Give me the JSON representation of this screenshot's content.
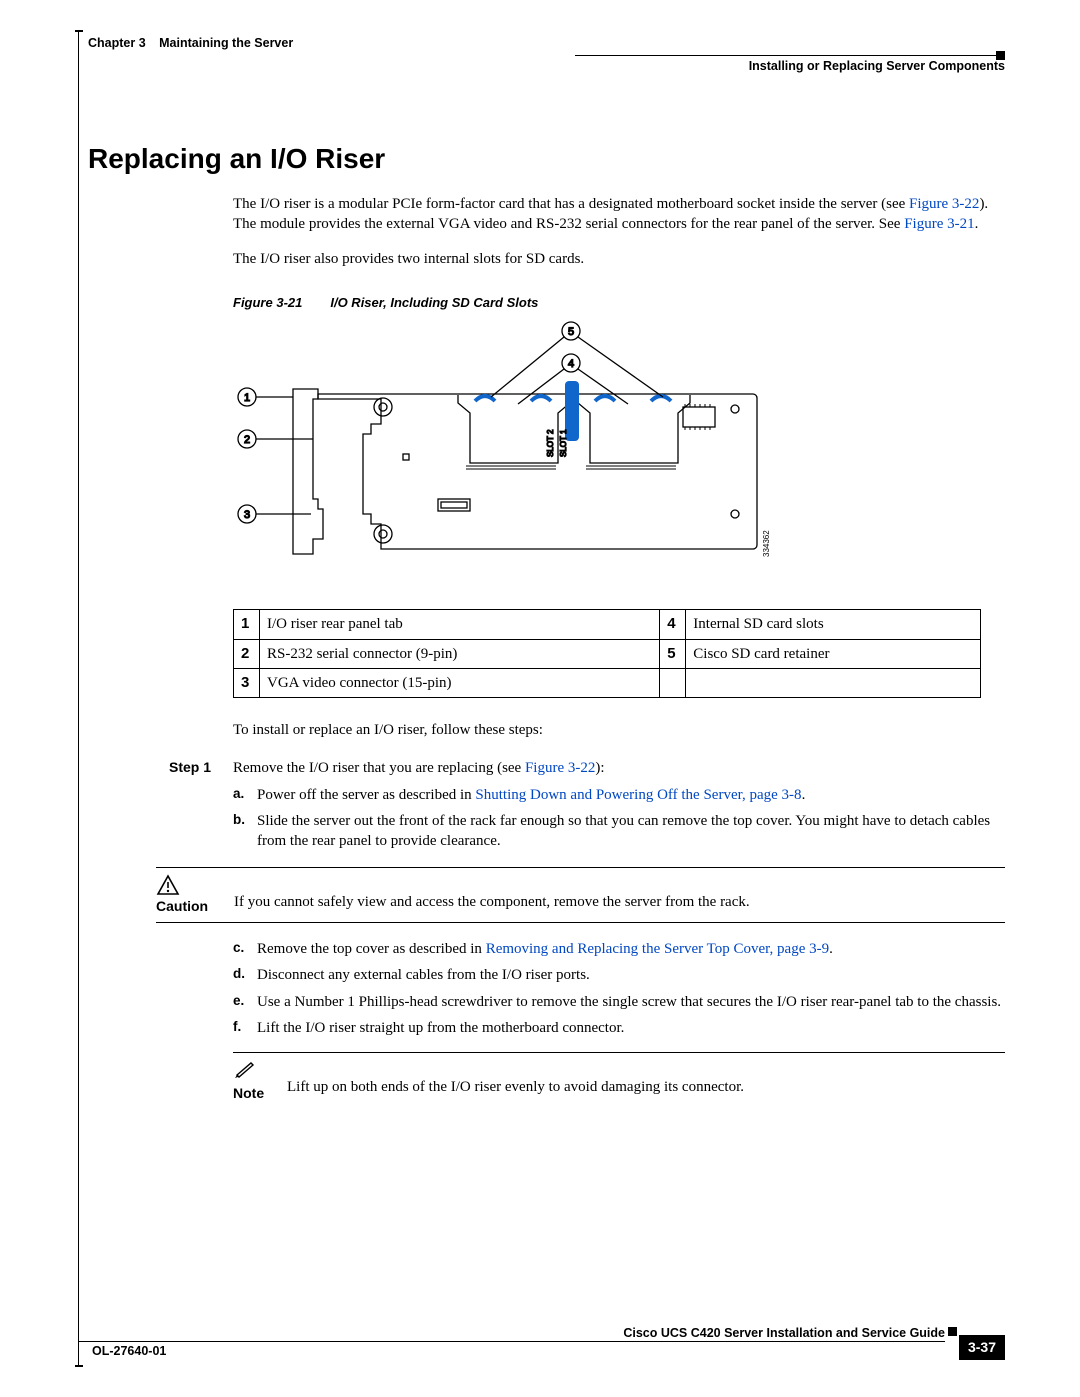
{
  "header": {
    "chapter_num": "Chapter 3",
    "chapter_title": "Maintaining the Server",
    "section": "Installing or Replacing Server Components"
  },
  "title": "Replacing an I/O Riser",
  "intro": {
    "p1a": "The I/O riser is a modular PCIe form-factor card that has a designated motherboard socket inside the server (see ",
    "p1_link1": "Figure 3-22",
    "p1b": "). The module provides the external VGA video and RS-232 serial connectors for the rear panel of the server. See ",
    "p1_link2": "Figure 3-21",
    "p1c": ".",
    "p2": "The I/O riser also provides two internal slots for SD cards."
  },
  "figure": {
    "label": "Figure 3-21",
    "caption": "I/O Riser, Including SD Card Slots",
    "callouts": [
      "1",
      "2",
      "3",
      "4",
      "5"
    ],
    "slot_labels": [
      "SLOT 2",
      "SLOT 1"
    ],
    "drawing_id": "334362"
  },
  "legend": [
    {
      "n": "1",
      "t": "I/O riser rear panel tab"
    },
    {
      "n": "2",
      "t": "RS-232 serial connector (9-pin)"
    },
    {
      "n": "3",
      "t": "VGA video connector (15-pin)"
    },
    {
      "n": "4",
      "t": "Internal SD card slots"
    },
    {
      "n": "5",
      "t": "Cisco SD card retainer"
    }
  ],
  "instr_lead": "To install or replace an I/O riser, follow these steps:",
  "step1": {
    "label": "Step 1",
    "lead_a": "Remove the I/O riser that you are replacing (see ",
    "lead_link": "Figure 3-22",
    "lead_b": "):",
    "a_pre": "Power off the server as described in ",
    "a_link": "Shutting Down and Powering Off the Server, page 3-8",
    "a_post": ".",
    "b": "Slide the server out the front of the rack far enough so that you can remove the top cover. You might have to detach cables from the rear panel to provide clearance."
  },
  "caution": {
    "label": "Caution",
    "text": "If you cannot safely view and access the component, remove the server from the rack."
  },
  "step1b": {
    "c_pre": "Remove the top cover as described in ",
    "c_link": "Removing and Replacing the Server Top Cover, page 3-9",
    "c_post": ".",
    "d": "Disconnect any external cables from the I/O riser ports.",
    "e": "Use a Number 1 Phillips-head screwdriver to remove the single screw that secures the I/O riser rear-panel tab to the chassis.",
    "f": "Lift the I/O riser straight up from the motherboard connector."
  },
  "note": {
    "label": "Note",
    "text": "Lift up on both ends of the I/O riser evenly to avoid damaging its connector."
  },
  "footer": {
    "guide": "Cisco UCS C420 Server Installation and Service Guide",
    "doc": "OL-27640-01",
    "page": "3-37"
  }
}
